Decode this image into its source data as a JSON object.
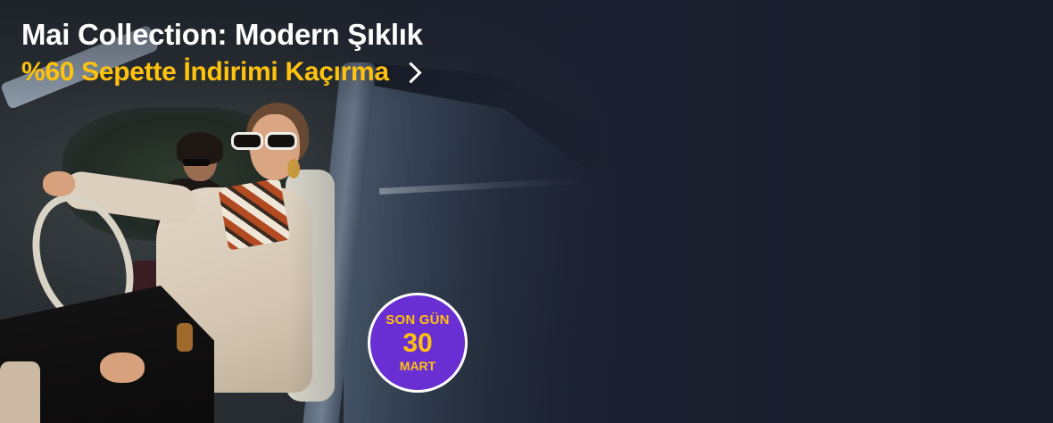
{
  "banner": {
    "title": "Mai Collection: Modern Şıklık",
    "subtitle": "%60 Sepette İndirimi Kaçırma",
    "link_icon": "chevron-right-icon",
    "badge": {
      "line1": "SON GÜN",
      "line2": "30",
      "line3": "MART"
    },
    "colors": {
      "background": "#1b2130",
      "title": "#ffffff",
      "subtitle": "#ffc20e",
      "badge_fill": "#6a2fd3",
      "badge_text": "#ffc20e"
    }
  }
}
